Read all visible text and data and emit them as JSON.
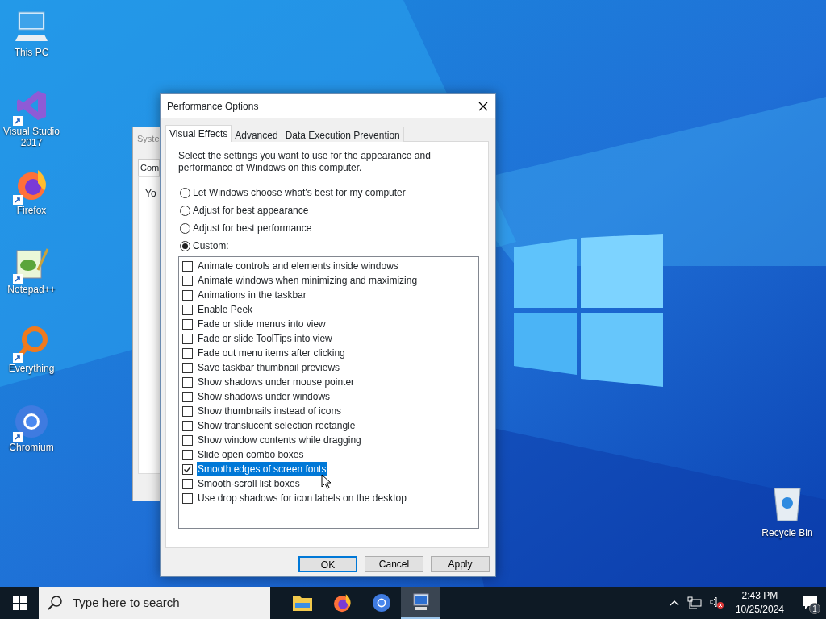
{
  "desktop_icons": [
    {
      "kind": "computer",
      "label": "This PC",
      "shortcut": false
    },
    {
      "kind": "vs",
      "label": "Visual Studio 2017",
      "shortcut": true
    },
    {
      "kind": "firefox",
      "label": "Firefox",
      "shortcut": true
    },
    {
      "kind": "notepad",
      "label": "Notepad++",
      "shortcut": true
    },
    {
      "kind": "everything",
      "label": "Everything",
      "shortcut": true
    },
    {
      "kind": "chromium",
      "label": "Chromium",
      "shortcut": true
    }
  ],
  "recycle_bin": {
    "label": "Recycle Bin"
  },
  "background_window": {
    "title": "Syste",
    "tab": "Com",
    "text": "Yo"
  },
  "dialog": {
    "title": "Performance Options",
    "tabs": [
      {
        "label": "Visual Effects",
        "selected": true
      },
      {
        "label": "Advanced",
        "selected": false
      },
      {
        "label": "Data Execution Prevention",
        "selected": false
      }
    ],
    "description": "Select the settings you want to use for the appearance and performance of Windows on this computer.",
    "options": [
      {
        "label": "Let Windows choose what's best for my computer",
        "selected": false
      },
      {
        "label": "Adjust for best appearance",
        "selected": false
      },
      {
        "label": "Adjust for best performance",
        "selected": false
      },
      {
        "label": "Custom:",
        "selected": true
      }
    ],
    "effects": [
      {
        "label": "Animate controls and elements inside windows",
        "checked": false,
        "selected": false
      },
      {
        "label": "Animate windows when minimizing and maximizing",
        "checked": false,
        "selected": false
      },
      {
        "label": "Animations in the taskbar",
        "checked": false,
        "selected": false
      },
      {
        "label": "Enable Peek",
        "checked": false,
        "selected": false
      },
      {
        "label": "Fade or slide menus into view",
        "checked": false,
        "selected": false
      },
      {
        "label": "Fade or slide ToolTips into view",
        "checked": false,
        "selected": false
      },
      {
        "label": "Fade out menu items after clicking",
        "checked": false,
        "selected": false
      },
      {
        "label": "Save taskbar thumbnail previews",
        "checked": false,
        "selected": false
      },
      {
        "label": "Show shadows under mouse pointer",
        "checked": false,
        "selected": false
      },
      {
        "label": "Show shadows under windows",
        "checked": false,
        "selected": false
      },
      {
        "label": "Show thumbnails instead of icons",
        "checked": false,
        "selected": false
      },
      {
        "label": "Show translucent selection rectangle",
        "checked": false,
        "selected": false
      },
      {
        "label": "Show window contents while dragging",
        "checked": false,
        "selected": false
      },
      {
        "label": "Slide open combo boxes",
        "checked": false,
        "selected": false
      },
      {
        "label": "Smooth edges of screen fonts",
        "checked": true,
        "selected": true
      },
      {
        "label": "Smooth-scroll list boxes",
        "checked": false,
        "selected": false
      },
      {
        "label": "Use drop shadows for icon labels on the desktop",
        "checked": false,
        "selected": false
      }
    ],
    "buttons": [
      {
        "label": "OK",
        "default": true
      },
      {
        "label": "Cancel",
        "default": false
      },
      {
        "label": "Apply",
        "default": false
      }
    ]
  },
  "taskbar": {
    "search": {
      "placeholder": "Type here to search"
    },
    "apps": [
      {
        "kind": "folder",
        "active": false
      },
      {
        "kind": "firefox",
        "active": false
      },
      {
        "kind": "chromium",
        "active": false
      },
      {
        "kind": "system",
        "active": true
      }
    ],
    "time": "2:43 PM",
    "date": "10/25/2024",
    "notification_count": "1"
  }
}
